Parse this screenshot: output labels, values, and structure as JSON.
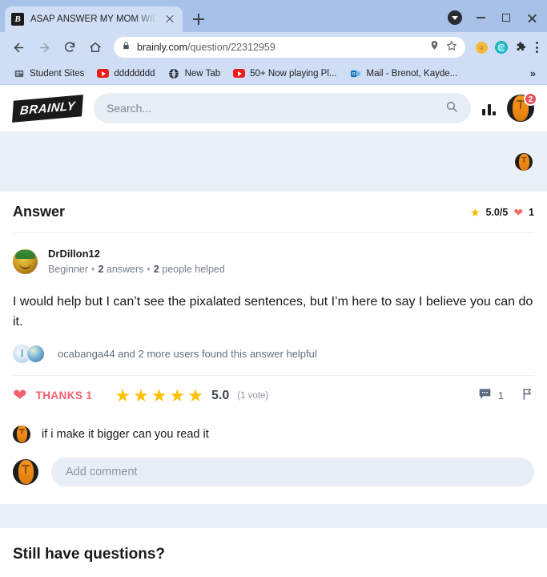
{
  "browser": {
    "tab": {
      "title": "ASAP ANSWER MY MOM WILL G",
      "favicon_letter": "B",
      "favicon_name": "brainly-favicon",
      "close_label": "Close tab"
    },
    "new_tab_label": "New Tab",
    "window_controls": {
      "profile": "profile-indicator",
      "minimize": "Minimize",
      "maximize": "Maximize",
      "close": "Close"
    },
    "nav": {
      "back": "Back",
      "forward": "Forward",
      "reload": "Reload",
      "home": "Home"
    },
    "omnibox": {
      "lock_icon": "lock-icon",
      "host": "brainly.com",
      "path": "/question/22312959",
      "location_icon": "location-pin-icon",
      "bookmark_icon": "star-icon"
    },
    "extensions": [
      {
        "name": "orange-extension-icon",
        "glyph": "☆"
      },
      {
        "name": "teal-extension-icon",
        "glyph": ""
      },
      {
        "name": "puzzle-extension-icon",
        "glyph": ""
      }
    ],
    "menu_label": "Customize and control Google Chrome",
    "bookmarks": [
      {
        "label": "Student Sites",
        "icon": "folder-icon"
      },
      {
        "label": "dddddddd",
        "icon": "youtube-icon"
      },
      {
        "label": "New Tab",
        "icon": "globe-icon"
      },
      {
        "label": "50+ Now playing Pl...",
        "icon": "youtube-icon"
      },
      {
        "label": "Mail - Brenot, Kayde...",
        "icon": "outlook-icon"
      }
    ],
    "bookmarks_overflow": "»"
  },
  "site": {
    "logo": "BRAINLY",
    "search": {
      "placeholder": "Search...",
      "value": "",
      "icon": "search-icon"
    },
    "stats_icon": "bar-chart-icon",
    "avatar": {
      "name": "user-avatar",
      "badge": "2"
    }
  },
  "answer": {
    "heading": "Answer",
    "rating_summary": "5.0/5",
    "thanks_summary": "1",
    "star_icon": "star-icon",
    "heart_icon": "heart-icon",
    "author": {
      "name": "DrDillon12",
      "rank": "Beginner",
      "answers_count": "2",
      "answers_label": "answers",
      "helped_count": "2",
      "helped_label": "people helped",
      "separator": "•"
    },
    "body": "I would help but I can’t see the pixalated sentences, but I’m here to say I believe you can do it.",
    "helpful_text": "ocabanga44 and 2 more users found this answer helpful",
    "actions": {
      "thanks_label": "THANKS",
      "thanks_count": "1",
      "stars": [
        "★",
        "★",
        "★",
        "★",
        "★"
      ],
      "rating_value": "5.0",
      "votes": "(1 vote)",
      "comments_count": "1",
      "comment_icon": "comment-icon",
      "flag_icon": "flag-icon"
    },
    "comments": [
      {
        "text": "if i make it bigger can you read it",
        "avatar": "commenter-avatar"
      }
    ],
    "add_comment": {
      "placeholder": "Add comment",
      "value": ""
    }
  },
  "footer": {
    "still_title": "Still have questions?"
  }
}
